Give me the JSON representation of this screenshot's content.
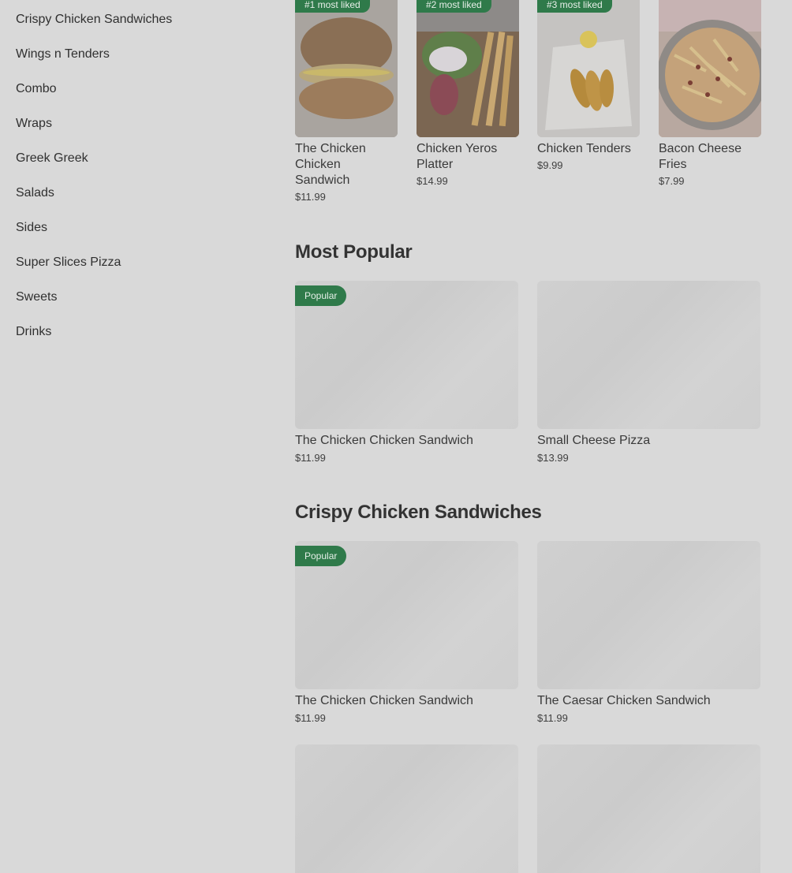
{
  "sidebar": {
    "items": [
      {
        "label": "Crispy Chicken Sandwiches"
      },
      {
        "label": "Wings n Tenders"
      },
      {
        "label": "Combo"
      },
      {
        "label": "Wraps"
      },
      {
        "label": "Greek Greek"
      },
      {
        "label": "Salads"
      },
      {
        "label": "Sides"
      },
      {
        "label": "Super Slices Pizza"
      },
      {
        "label": "Sweets"
      },
      {
        "label": "Drinks"
      }
    ]
  },
  "most_liked": [
    {
      "badge": "#1 most liked",
      "name": "The Chicken Chicken Sandwich",
      "price": "$11.99",
      "icon": "chicken-sandwich-photo"
    },
    {
      "badge": "#2 most liked",
      "name": "Chicken Yeros Platter",
      "price": "$14.99",
      "icon": "gyro-platter-photo"
    },
    {
      "badge": "#3 most liked",
      "name": "Chicken Tenders",
      "price": "$9.99",
      "icon": "chicken-tenders-photo"
    },
    {
      "badge": "",
      "name": "Bacon Cheese Fries",
      "price": "$7.99",
      "icon": "bacon-cheese-fries-photo"
    }
  ],
  "most_popular": {
    "title": "Most Popular",
    "items": [
      {
        "pill": "Popular",
        "name": "The Chicken Chicken Sandwich",
        "price": "$11.99"
      },
      {
        "pill": "",
        "name": "Small Cheese Pizza",
        "price": "$13.99"
      }
    ]
  },
  "crispy": {
    "title": "Crispy Chicken Sandwiches",
    "items": [
      {
        "pill": "Popular",
        "name": "The Chicken Chicken Sandwich",
        "price": "$11.99"
      },
      {
        "pill": "",
        "name": "The Caesar Chicken Sandwich",
        "price": "$11.99"
      }
    ]
  },
  "colors": {
    "accent": "#2f7a4a",
    "overlay_bg": "#d9d9d9"
  }
}
